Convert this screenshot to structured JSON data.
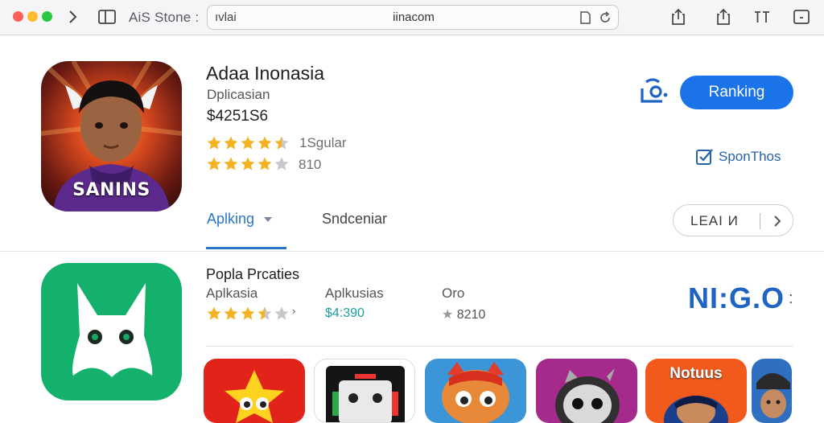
{
  "toolbar": {
    "title": "AiS Stone :",
    "address_left": "ıvlai",
    "address_url": "iinacom"
  },
  "hero": {
    "icon_label": "SANINS",
    "title": "Adaa Inonasia",
    "subtitle": "Dplicasian",
    "price": "$4251S6",
    "rating1": {
      "stars": 4.5,
      "text": "1Sgular"
    },
    "rating2": {
      "stars": 4,
      "text": "810"
    },
    "ranking_button": "Ranking",
    "sport_link": "SponThos"
  },
  "tabs": {
    "active": "Aplking",
    "other": "Sndceniar"
  },
  "learn_button": "LEAI И",
  "section2": {
    "title": "Popla Prcaties",
    "col1_label": "Aplkasia",
    "col1_rating": {
      "stars": 3.5
    },
    "col2_label": "Aplkusias",
    "col2_price": "$4:390",
    "col3_label": "Oro",
    "col3_rating_text": "8210",
    "brand": "NI:G.O",
    "brand_dots": ":"
  },
  "tiles": [
    {
      "name": "star-game",
      "label": ""
    },
    {
      "name": "robot-game",
      "label": ""
    },
    {
      "name": "fox-game",
      "label": ""
    },
    {
      "name": "ninja-game",
      "label": ""
    },
    {
      "name": "notuus-game",
      "label": "Notuus"
    },
    {
      "name": "portrait-game",
      "label": ""
    }
  ],
  "colors": {
    "accent_blue": "#1a73e8",
    "link_blue": "#2c75c4",
    "star_gold": "#f5b324",
    "green_icon": "#14b16c",
    "price_teal": "#1b9e9a"
  }
}
